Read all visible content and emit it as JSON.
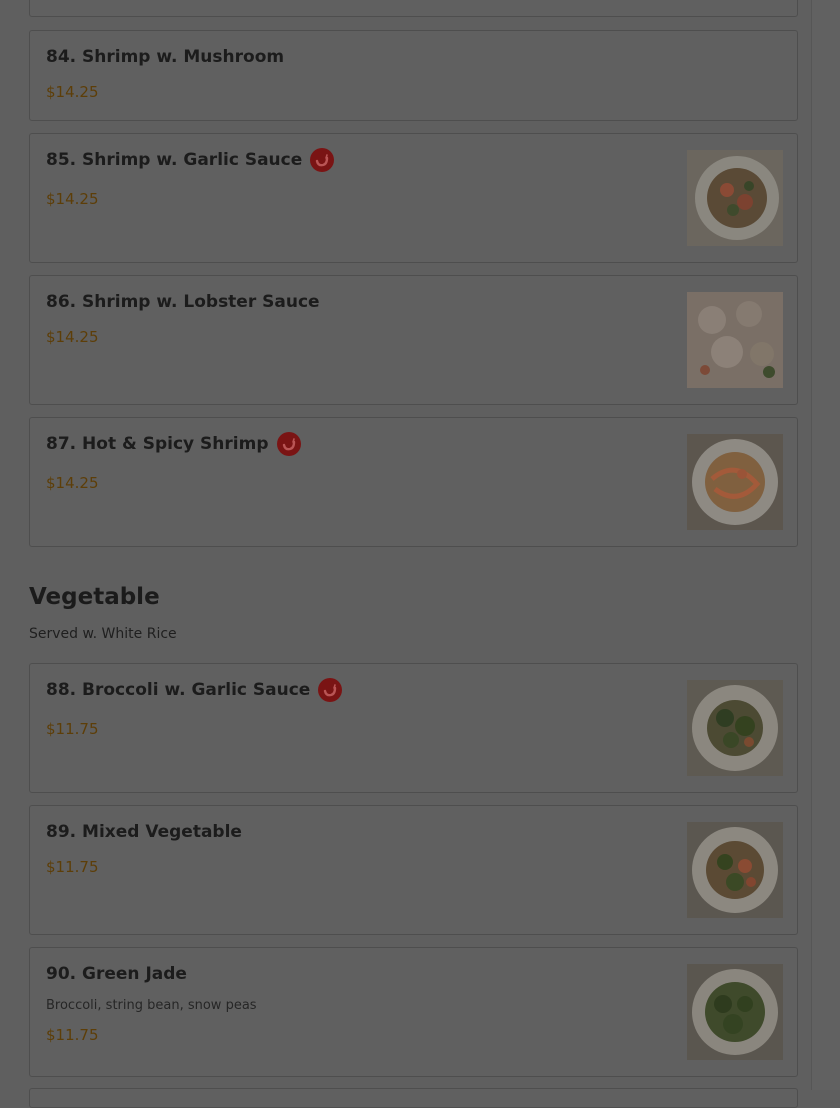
{
  "items": [
    {
      "name": "84. Shrimp w. Mushroom",
      "price": "$14.25"
    },
    {
      "name": "85. Shrimp w. Garlic Sauce",
      "price": "$14.25",
      "spicy": true,
      "photo": "food-photo-shrimp-garlic"
    },
    {
      "name": "86. Shrimp w. Lobster Sauce",
      "price": "$14.25",
      "photo": "food-photo-shrimp-lobster"
    },
    {
      "name": "87. Hot & Spicy Shrimp",
      "price": "$14.25",
      "spicy": true,
      "photo": "food-photo-spicy-shrimp"
    },
    {
      "name": "88. Broccoli w. Garlic Sauce",
      "price": "$11.75",
      "spicy": true,
      "photo": "food-photo-broccoli-garlic"
    },
    {
      "name": "89. Mixed Vegetable",
      "price": "$11.75",
      "photo": "food-photo-mixed-vegetable"
    },
    {
      "name": "90. Green Jade",
      "description": "Broccoli, string bean, snow peas",
      "price": "$11.75",
      "photo": "food-photo-green-jade"
    }
  ],
  "section": {
    "title": "Vegetable",
    "subtitle": "Served w. White Rice"
  },
  "colors": {
    "overlay_bg": "#5f5f5f",
    "price": "#5d3e08",
    "spicy_badge": "#7a1414"
  }
}
